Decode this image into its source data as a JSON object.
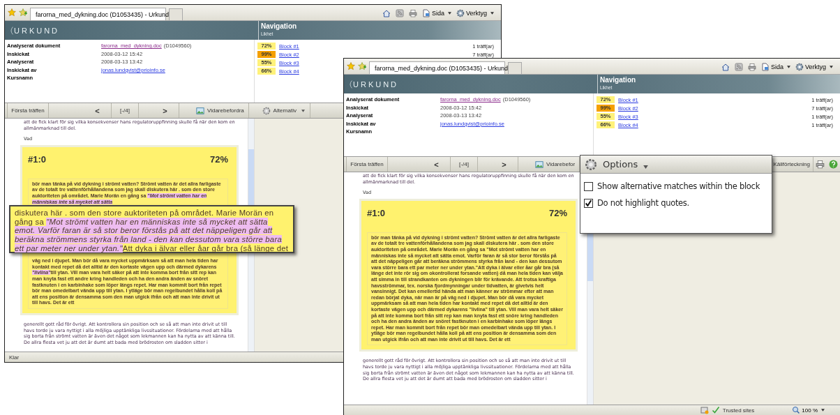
{
  "windows": [
    {
      "tab_title": "farorna_med_dykning.doc (D1053435) - Urkund",
      "command_bar": {
        "page": "Sida",
        "tools": "Verktyg"
      },
      "logo": "URKUND",
      "navigation": {
        "title": "Navigation",
        "column": "Likhet",
        "blocks": [
          {
            "percent": "72%",
            "link": "Block #1",
            "hits": "1 träff(ar)",
            "color": "#fff27a"
          },
          {
            "percent": "99%",
            "link": "Block #2",
            "hits": "7 träff(ar)",
            "color": "#f5a000"
          },
          {
            "percent": "55%",
            "link": "Block #3",
            "color": "#fff27a"
          },
          {
            "percent": "66%",
            "link": "Block #4",
            "color": "#fff27a"
          }
        ]
      },
      "info": [
        {
          "label": "Analyserat dokument",
          "value": "farorna_med_dykning.doc",
          "kind": "doc-link",
          "extra": "(D1049560)"
        },
        {
          "label": "Inskickat",
          "value": "2008-03-12 15:42",
          "kind": "text"
        },
        {
          "label": "Analyserat",
          "value": "2008-03-13 13:42",
          "kind": "text"
        },
        {
          "label": "Inskickat av",
          "value": "jonas.lundqvist@prioinfo.se",
          "kind": "mail-link"
        },
        {
          "label": "Kursnamn"
        }
      ],
      "toolbar": [
        {
          "kind": "first",
          "label": "Första träffen"
        },
        {
          "kind": "prev",
          "label": "<"
        },
        {
          "kind": "counter",
          "label": "[-/4]"
        },
        {
          "kind": "next",
          "label": ">"
        },
        {
          "kind": "forward",
          "label": "Vidarebefordra"
        },
        {
          "kind": "options",
          "label": "Alternativ"
        }
      ],
      "document": {
        "before": "att de fick klart för sig vilka konsekvenser hans regulatoruppfinning skulle få när den kom en allmänmarknad till del.",
        "heading": "Vad",
        "match": {
          "id": "#1:0",
          "percent": "72%",
          "segments_above": [
            {
              "text": "bör man tänka på vid dykning i strömt vatten? Strömt vatten är det allra farligaste av de totalt tre vattenförhållandena som jag skall diskutera här . som den store auktoriteten på området. Marie Morän en gång sa ",
              "quote": false
            },
            {
              "text": "\"Mot strömt vatten har en människas inte så mycket att sätta",
              "quote": true
            }
          ],
          "segments_below": [
            {
              "text": "väg ned i djupet. Man bör då vara mycket uppmärksam så att man hela tiden har kontakt med repet då det alltid är den kortaste vägen upp och därmed dykarens ",
              "quote": false
            },
            {
              "text": "\"livlina\"",
              "quote": true
            },
            {
              "text": "till ytan. Vill man vara helt säker på att inte komma bort från sitt rep kan man knyta fast ett andre kring handleden och ha den andra änden av snöret fastknuten i en karbinhake som löper längs repet. Har man kommit bort från repet bör man omedelbart vända upp till ytan. I ytläge bör man regelbundet hålla koll på att ens position är densamma som den man utgick ifrån och att man inte drivit ut till havs. Det är ett",
              "quote": false
            }
          ]
        },
        "after": "generellt gott råd för övrigt. Att kontrollera sin position och se så att man inte drivit ut till havs torde ju vara nyttigt i alla möjliga upptänkliga livssituationer. Fördelarna med att hålla sig borta från strömt vatten är även det något som lekmannen kan ha nytta av att känna till. De allra flesta vet ju att det är dumt att bada med brödrosten om sladden sitter i"
      },
      "status": {
        "text": "Klar"
      }
    },
    {
      "tab_title": "farorna_med_dykning.doc (D1053435) - Urkund",
      "command_bar": {
        "page": "Sida",
        "tools": "Verktyg"
      },
      "logo": "URKUND",
      "navigation": {
        "title": "Navigation",
        "column": "Likhet",
        "blocks": [
          {
            "percent": "72%",
            "link": "Block #1",
            "hits": "1 träff(ar)",
            "color": "#fff27a"
          },
          {
            "percent": "99%",
            "link": "Block #2",
            "hits": "7 träff(ar)",
            "color": "#f5a000"
          },
          {
            "percent": "55%",
            "link": "Block #3",
            "hits": "1 träff(ar)",
            "color": "#fff27a"
          },
          {
            "percent": "66%",
            "link": "Block #4",
            "hits": "1 träff(ar)",
            "color": "#fff27a"
          }
        ]
      },
      "info": [
        {
          "label": "Analyserat dokument",
          "value": "farorna_med_dykning.doc",
          "kind": "doc-link",
          "extra": "(D1049560)"
        },
        {
          "label": "Inskickat",
          "value": "2008-03-12 15:42",
          "kind": "text"
        },
        {
          "label": "Analyserat",
          "value": "2008-03-13 13:42",
          "kind": "text"
        },
        {
          "label": "Inskickat av",
          "value": "jonas.lundqvist@prioinfo.se",
          "kind": "mail-link"
        },
        {
          "label": "Kursnamn"
        }
      ],
      "toolbar": [
        {
          "kind": "first",
          "label": "Första träffen"
        },
        {
          "kind": "prev",
          "label": "<"
        },
        {
          "kind": "counter",
          "label": "[-/4]"
        },
        {
          "kind": "next",
          "label": ">"
        },
        {
          "kind": "forward",
          "label": "Vidarebefor"
        },
        {
          "kind": "sources",
          "label": "Källförteckning"
        },
        {
          "kind": "print"
        },
        {
          "kind": "help"
        }
      ],
      "document": {
        "before": "att de fick klart för sig vilka konsekvenser hans regulatoruppfinning skulle få när den kom en allmänmarknad till del.",
        "heading": "Vad",
        "match": {
          "id": "#1:0",
          "percent": "72%",
          "segments_above": [
            {
              "text": "bör man tänka på vid dykning i strömt vatten? Strömt vatten är det allra farligaste av de totalt tre vattenförhållandena som jag skall diskutera här . som den store auktoriteten på området. Marie Morän en gång sa \"Mot strömt vatten har en människas inte så mycket att sätta emot. Varför faran är så stor beror förstås på att det näppeligen går att beräkna strömmens styrka från land - den kan dessutom vara större bara ett par meter ner under ytan.\"Att dyka i älvar eller åar går bra (så länge det inte rör sig om okontrollerat forsande vatten) då man hela tiden kan välja att simma in till strandkanten om dykningen blir för krävande. Att trotsa kraftiga havsströmmar, tex. norska fjordmynningar under tidvatten, är givetvis helt vansinnigt. Det kan emellertid hända att man känner av strömmar efter att man redan börjat dyka, när man är på väg ned i djupet. Man bör då vara mycket uppmärksam så att man hela tiden har kontakt med repet då det alltid är den kortaste vägen upp och därmed dykarens \"livlina\" till ytan. Vill man vara helt säker på att inte komma bort från sitt rep kan man knyta fast ett snöre kring handleden och ha den andra änden av snöret fastknuten i en karbinhake som löper längs repet. Har man kommit bort från repet bör man omedelbart vända upp till ytan. I ytläge bör man regelbundet hålla koll på att ens position är densamma som den man utgick ifrån och att man inte drivit ut till havs. Det är ett",
              "quote": false
            }
          ]
        },
        "after": "generellt gott råd för övrigt. Att kontrollera sin position och se så att man inte drivit ut till havs torde ju vara nyttigt i alla möjliga upptänkliga livssituationer. Fördelarna med att hålla sig borta från strömt vatten är även det något som lekmannen kan ha nytta av att känna till. De allra flesta vet ju att det är dumt att bada med brödrosten om sladden sitter i"
      },
      "status": {
        "zone": "Trusted sites",
        "zoom": "100 %"
      }
    }
  ],
  "magnifier": {
    "segments": [
      {
        "text": "diskutera här . som den store auktoriteten på området. Marie Morän en gång sa ",
        "quote": false
      },
      {
        "text": "\"Mot strömt vatten har en människas inte så mycket att sätta emot. Varför faran är så stor beror förstås på att det näppeligen går att beräkna strömmens styrka från land - den kan dessutom vara större bara ett par meter ner under ytan.\"",
        "quote": true
      },
      {
        "text": "Att dyka i älvar eller åar går bra (så länge det",
        "quote": false
      }
    ]
  },
  "options_popup": {
    "title": "Options",
    "options": [
      {
        "label": "Show alternative matches within the block",
        "checked": false
      },
      {
        "label": "Do not highlight quotes.",
        "checked": true
      }
    ]
  }
}
